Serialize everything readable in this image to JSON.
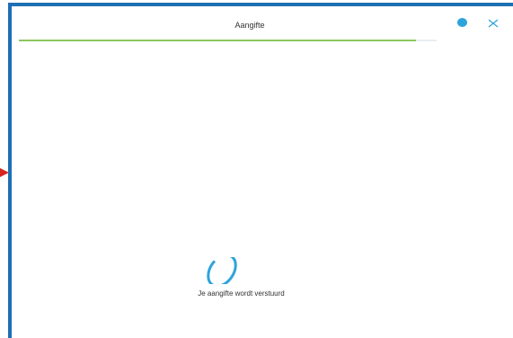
{
  "dialog": {
    "title": "Aangifte",
    "status_text": "Je aangifte wordt verstuurd",
    "progress_fraction": 0.95
  },
  "icons": {
    "status_dot": "dot-icon",
    "close": "close-icon",
    "spinner": "loading-spinner-icon",
    "edge_marker": "arrow-right-icon"
  },
  "colors": {
    "border": "#1f6fb4",
    "accent": "#2da3dc",
    "progress": "#8cc65e",
    "marker": "#d6261f"
  }
}
